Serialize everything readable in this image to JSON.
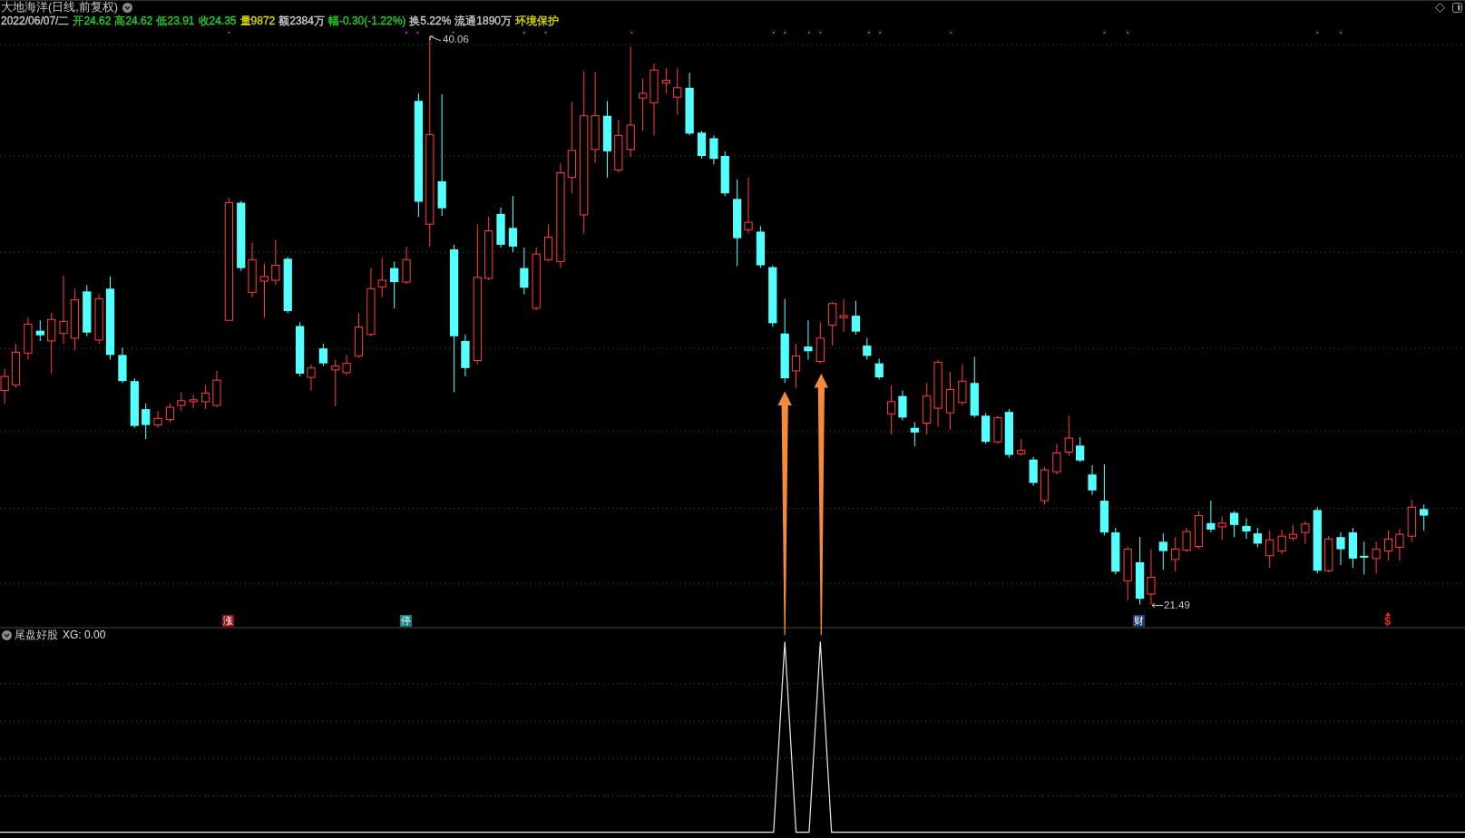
{
  "header": {
    "title": "大地海洋(日线,前复权)",
    "quote": [
      {
        "text": "2022/06/07/二",
        "color": "#c8c8c8"
      },
      {
        "text": "开24.62",
        "color": "#22d022"
      },
      {
        "text": "高24.62",
        "color": "#22d022"
      },
      {
        "text": "低23.91",
        "color": "#22d022"
      },
      {
        "text": "收24.35",
        "color": "#22d022"
      },
      {
        "text": "量9872",
        "color": "#d8d800"
      },
      {
        "text": "额2384万",
        "color": "#c8c8c8"
      },
      {
        "text": "幅-0.30(-1.22%)",
        "color": "#22d022"
      },
      {
        "text": "换5.22%",
        "color": "#c8c8c8"
      },
      {
        "text": "流通1890万",
        "color": "#c8c8c8"
      },
      {
        "text": "环境保护",
        "color": "#d8d800"
      }
    ]
  },
  "chart": {
    "high_label": "40.06",
    "low_label": "21.49",
    "markers": [
      {
        "kind": "badge",
        "text": "涨",
        "color": "#8e1010"
      },
      {
        "kind": "badge",
        "text": "停",
        "color": "#0e8080"
      },
      {
        "kind": "badge",
        "text": "财",
        "color": "#1c3f73"
      },
      {
        "kind": "symbol",
        "text": "$",
        "color": "#ff2020"
      }
    ]
  },
  "indicator": {
    "name": "尾盘好股",
    "readout": "XG: 0.00"
  }
}
